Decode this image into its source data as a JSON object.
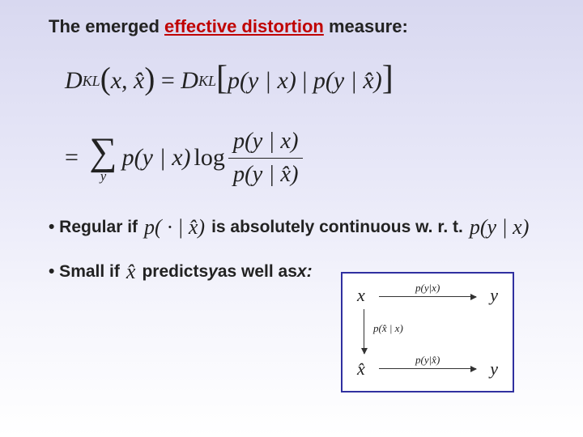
{
  "title": {
    "pre": "The emerged ",
    "highlight": "effective distortion",
    "post": " measure:"
  },
  "equation": {
    "lhs_func": "D",
    "lhs_sub": "KL",
    "lhs_arg": "x, x̂",
    "rhs1_func": "D",
    "rhs1_sub": "KL",
    "rhs1_arg_left": "p(y | x)",
    "rhs1_arg_right": "p(y | x̂)",
    "row2_sum_var": "y",
    "row2_factor": "p(y | x)",
    "row2_log": "log",
    "row2_num": "p(y | x)",
    "row2_den": "p(y | x̂)"
  },
  "bullet1": {
    "pre": "• Regular if ",
    "math": "p( · | x̂)",
    "post": " is absolutely continuous w. r. t. ",
    "math2": "p(y | x)"
  },
  "bullet2": {
    "pre": "• Small if ",
    "math": "x̂",
    "mid": " predicts ",
    "y": "y",
    "mid2": " as well as ",
    "x": "x:"
  },
  "diagram": {
    "x": "x",
    "y_top": "y",
    "xhat": "x̂",
    "y_bot": "y",
    "label_top": "p(y|x)",
    "label_left": "p(x̂ | x)",
    "label_bot": "p(y|x̂)"
  }
}
